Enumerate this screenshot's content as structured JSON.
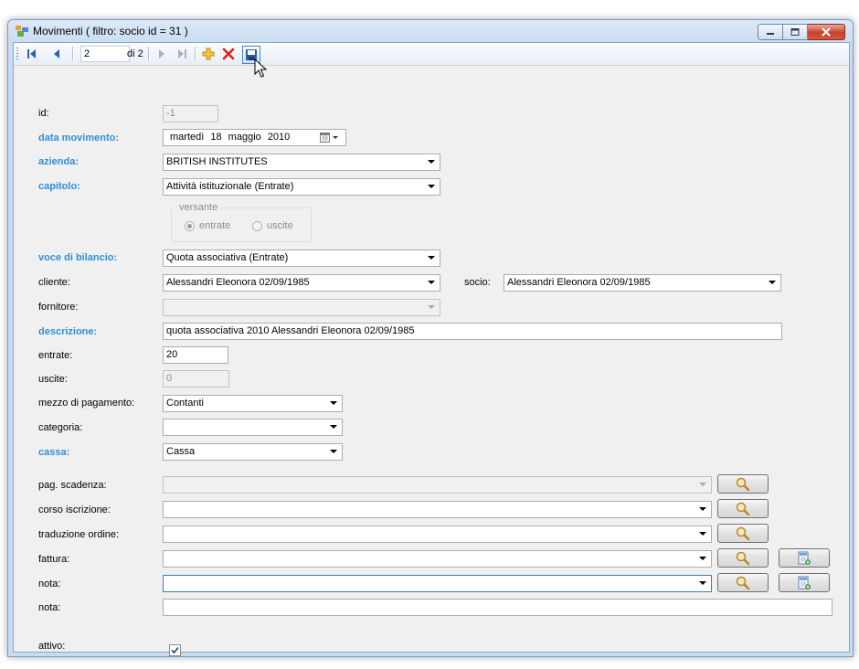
{
  "window": {
    "title": "Movimenti ( filtro: socio id = 31 )"
  },
  "navigator": {
    "position": "2",
    "count_label": "di 2"
  },
  "labels": {
    "id": "id:",
    "data_movimento": "data movimento:",
    "azienda": "azienda:",
    "capitolo": "capitolo:",
    "voce": "voce di bilancio:",
    "cliente": "cliente:",
    "socio": "socio:",
    "fornitore": "fornitore:",
    "descrizione": "descrizione:",
    "entrate": "entrate:",
    "uscite": "uscite:",
    "mezzo": "mezzo di pagamento:",
    "categoria": "categoria:",
    "cassa": "cassa:",
    "pag_scadenza": "pag. scadenza:",
    "corso": "corso iscrizione:",
    "traduzione": "traduzione ordine:",
    "fattura": "fattura:",
    "nota1": "nota:",
    "nota2": "nota:",
    "attivo": "attivo:"
  },
  "fields": {
    "id": "-1",
    "date": {
      "day_name": "martedì",
      "day": "18",
      "month": "maggio",
      "year": "2010"
    },
    "azienda": "BRITISH INSTITUTES",
    "capitolo": "Attività istituzionale (Entrate)",
    "voce": "Quota associativa (Entrate)",
    "cliente": "Alessandri Eleonora 02/09/1985",
    "socio": "Alessandri Eleonora 02/09/1985",
    "fornitore": "",
    "descrizione": "quota associativa 2010 Alessandri Eleonora 02/09/1985",
    "entrate": "20",
    "uscite": "0",
    "mezzo": "Contanti",
    "categoria": "",
    "cassa": "Cassa",
    "pag_scadenza": "",
    "corso": "",
    "traduzione": "",
    "fattura": "",
    "nota_combo": "",
    "nota_text": "",
    "attivo": true
  },
  "versante": {
    "title": "versante",
    "entrate": "entrate",
    "uscite": "uscite",
    "selected": "entrate"
  },
  "icons": [
    "first-record-icon",
    "prev-record-icon",
    "next-record-icon",
    "last-record-icon",
    "add-icon",
    "delete-icon",
    "save-icon",
    "search-icon",
    "new-document-icon",
    "calendar-icon",
    "dropdown-arrow-icon",
    "cursor-icon"
  ],
  "colors": {
    "required_label": "#2f8fd8",
    "add_icon": "#f0a818",
    "delete_icon": "#e02020"
  }
}
